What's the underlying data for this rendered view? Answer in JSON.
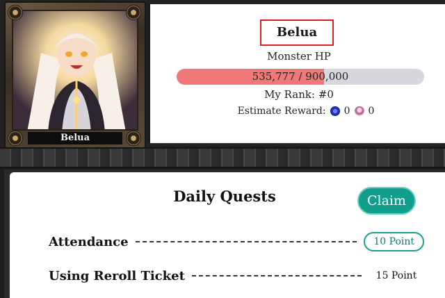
{
  "card": {
    "name": "Belua"
  },
  "monster": {
    "name": "Belua",
    "hp_label": "Monster HP",
    "hp_current": 535777,
    "hp_max": 900000,
    "hp_text": "535,777 / 900,000",
    "rank_text": "My Rank: #0",
    "reward_label": "Estimate Reward:",
    "reward_coin_value": "0",
    "reward_avatar_value": "0"
  },
  "quests": {
    "title": "Daily Quests",
    "claim_label": "Claim",
    "items": [
      {
        "name": "Attendance",
        "points": "10 Point"
      },
      {
        "name": "Using Reroll Ticket",
        "points": "15 Point"
      }
    ]
  },
  "colors": {
    "hp_fill": "#f07878",
    "hp_track": "#d6d8de",
    "accent": "#119f8c",
    "highlight_box": "#e01b1b"
  },
  "icons": {
    "reward_coin": "blue-coin-icon",
    "reward_avatar": "character-avatar-icon"
  }
}
